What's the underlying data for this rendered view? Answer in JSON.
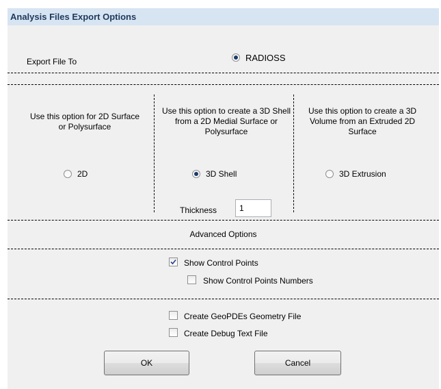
{
  "dialog": {
    "title": "Analysis Files Export Options"
  },
  "export": {
    "label": "Export File To",
    "radioss_label": "RADIOSS",
    "radioss_selected": true
  },
  "options": {
    "col_2d": {
      "description": "Use this option for 2D Surface or Polysurface",
      "radio_label": "2D",
      "selected": false
    },
    "col_shell": {
      "description": "Use this option to create a 3D Shell from a 2D Medial Surface or Polysurface",
      "radio_label": "3D Shell",
      "selected": true,
      "thickness_label": "Thickness",
      "thickness_value": "1"
    },
    "col_extrusion": {
      "description": "Use this option to create a 3D Volume from an Extruded 2D Surface",
      "radio_label": "3D Extrusion",
      "selected": false
    }
  },
  "advanced": {
    "header": "Advanced Options",
    "show_control_points": {
      "label": "Show Control Points",
      "checked": true
    },
    "show_control_points_numbers": {
      "label": "Show Control Points Numbers",
      "checked": false
    },
    "create_geopdes": {
      "label": "Create GeoPDEs Geometry File",
      "checked": false
    },
    "create_debug": {
      "label": "Create Debug Text File",
      "checked": false
    }
  },
  "buttons": {
    "ok": "OK",
    "cancel": "Cancel"
  }
}
